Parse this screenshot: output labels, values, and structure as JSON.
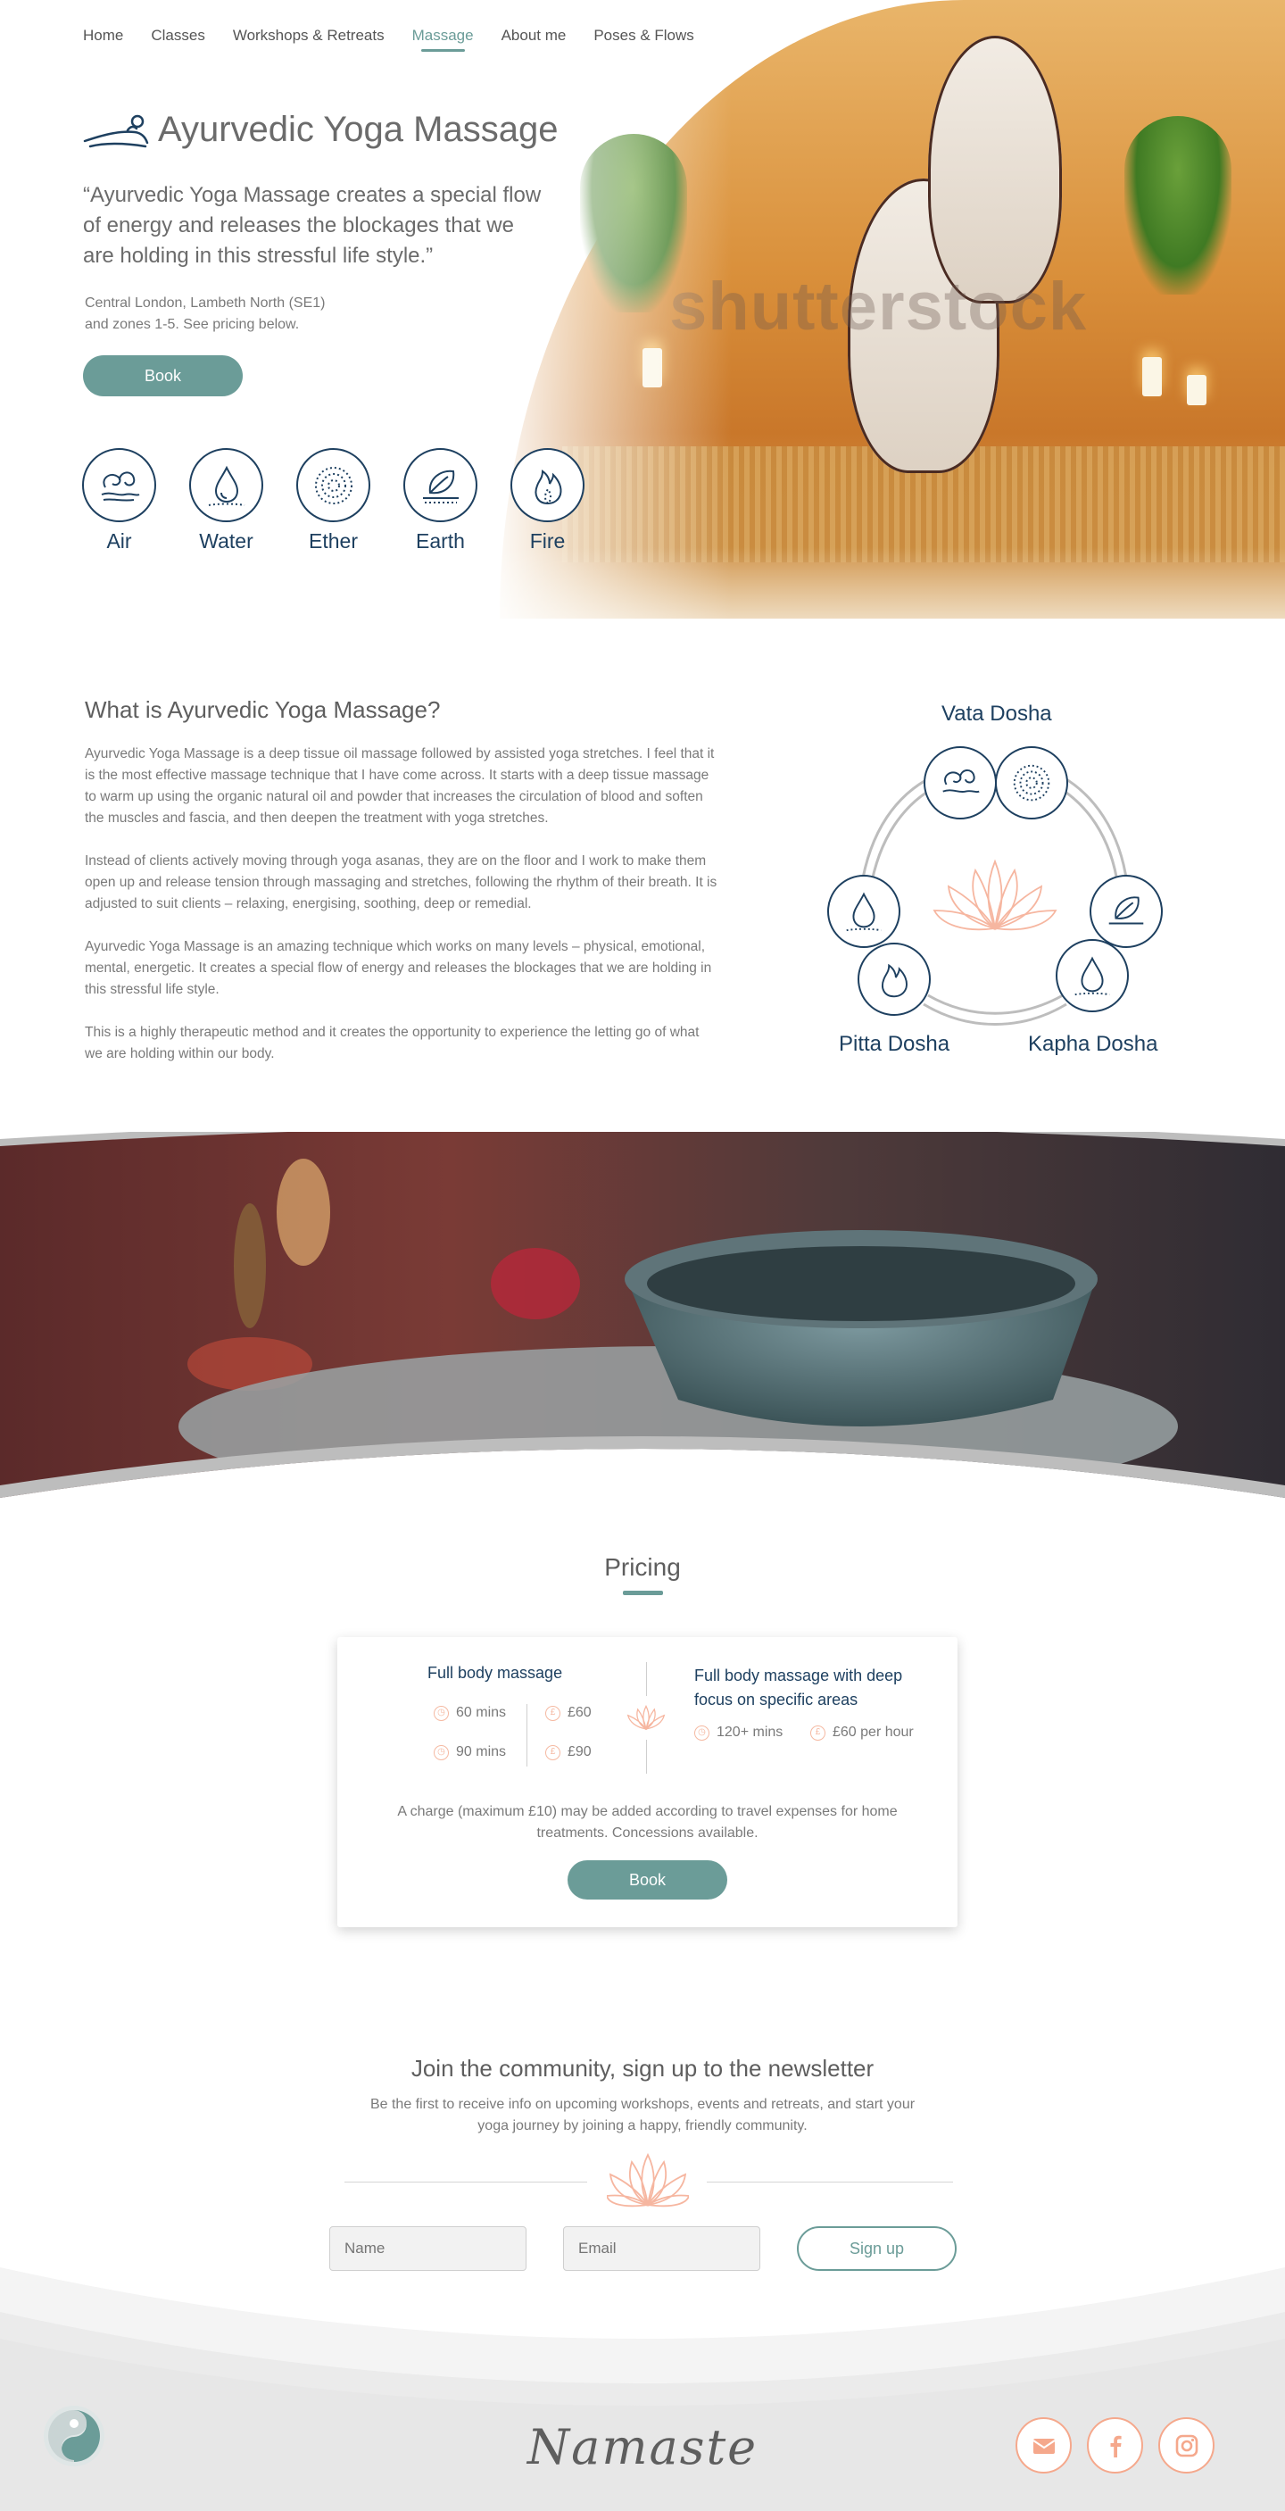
{
  "nav": {
    "items": [
      {
        "label": "Home"
      },
      {
        "label": "Classes"
      },
      {
        "label": "Workshops & Retreats"
      },
      {
        "label": "Massage"
      },
      {
        "label": "About me"
      },
      {
        "label": "Poses & Flows"
      }
    ],
    "active": "Massage"
  },
  "hero": {
    "title": "Ayurvedic Yoga Massage",
    "quote": "“Ayurvedic Yoga Massage creates a special flow of energy and releases the blockages that we are holding in this stressful life style.”",
    "location_line1": "Central London, Lambeth North (SE1)",
    "location_line2": "and zones 1-5. See pricing below.",
    "book_label": "Book",
    "watermark": "shutterstock",
    "elements": [
      {
        "label": "Air",
        "icon": "air-swirl-icon"
      },
      {
        "label": "Water",
        "icon": "water-drop-icon"
      },
      {
        "label": "Ether",
        "icon": "ether-spiral-icon"
      },
      {
        "label": "Earth",
        "icon": "earth-leaf-icon"
      },
      {
        "label": "Fire",
        "icon": "fire-flame-icon"
      }
    ]
  },
  "about": {
    "heading": "What is Ayurvedic Yoga Massage?",
    "paragraphs": [
      "Ayurvedic Yoga Massage is a deep tissue oil massage followed by assisted yoga stretches. I feel that it is the most effective massage technique that I have come across. It starts with a deep tissue massage to warm up using the organic natural oil and powder that increases the circulation of blood and soften the muscles and fascia, and then deepen the treatment with yoga stretches.",
      "Instead of clients actively moving through yoga asanas, they are on the floor and I work to make them open up and release tension through massaging and stretches, following the rhythm of their breath. It is adjusted to suit clients – relaxing, energising, soothing, deep or remedial.",
      "Ayurvedic Yoga Massage is an amazing technique which works on many levels – physical, emotional, mental, energetic. It creates a special flow of energy and releases the blockages that we are holding in this stressful life style.",
      "This is a highly therapeutic method and it creates the opportunity to experience the letting go of what we are holding within our body."
    ]
  },
  "dosha": {
    "vata": "Vata Dosha",
    "pitta": "Pitta Dosha",
    "kapha": "Kapha Dosha"
  },
  "pricing": {
    "title": "Pricing",
    "option1_title": "Full body massage",
    "option1_rows": [
      {
        "duration": "60 mins",
        "price": "£60"
      },
      {
        "duration": "90 mins",
        "price": "£90"
      }
    ],
    "option2_title": "Full body massage with deep focus on specific areas",
    "option2_duration": "120+ mins",
    "option2_price": "£60 per hour",
    "note": "A charge (maximum £10) may be added according to travel expenses for home treatments.  Concessions available.",
    "book_label": "Book"
  },
  "newsletter": {
    "title": "Join the community, sign up to the newsletter",
    "subtitle": "Be the first to receive info on upcoming workshops, events and retreats, and start your yoga journey by joining a happy, friendly community.",
    "name_placeholder": "Name",
    "email_placeholder": "Email",
    "signup_label": "Sign up"
  },
  "footer": {
    "tagline": "Namaste",
    "social": [
      {
        "icon": "email-icon"
      },
      {
        "icon": "facebook-icon"
      },
      {
        "icon": "instagram-icon"
      }
    ]
  },
  "colors": {
    "teal": "#6b9c98",
    "navy": "#1e4060",
    "peach": "#f5a88c",
    "text_gray": "#6b6b6b"
  }
}
